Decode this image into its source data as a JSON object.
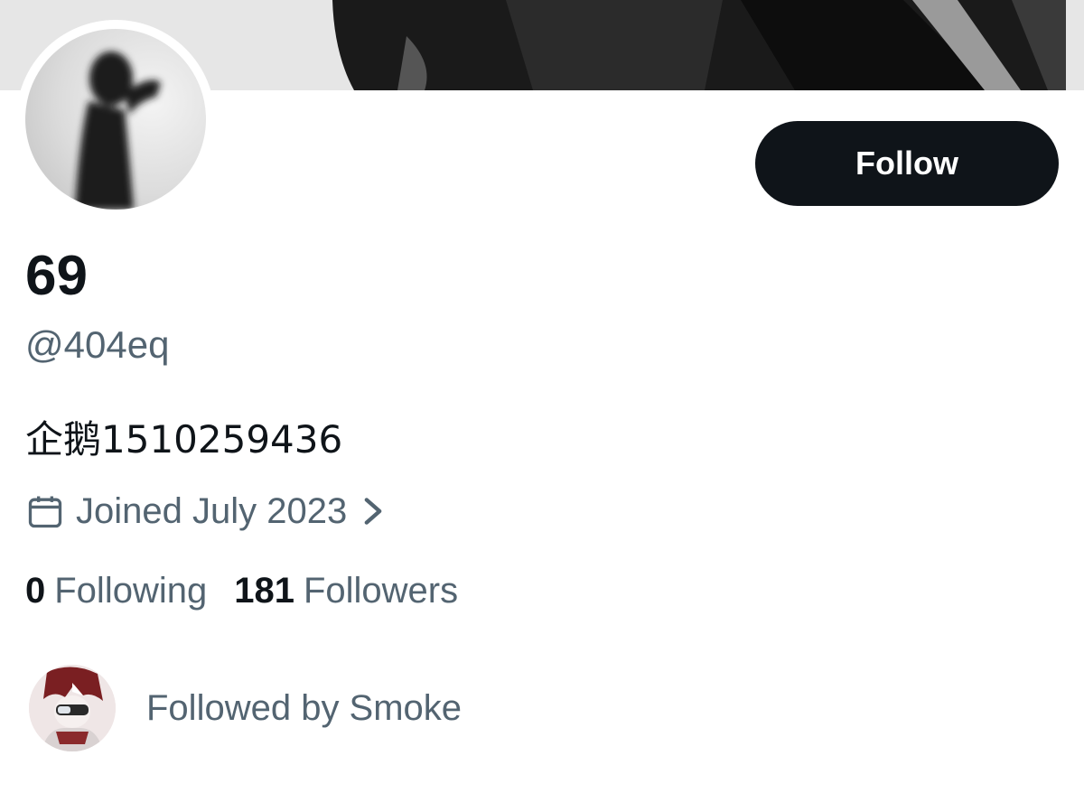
{
  "profile": {
    "display_name": "69",
    "handle": "@404eq",
    "bio": "企鹅1510259436",
    "joined": "Joined July 2023",
    "following_count": "0",
    "following_label": "Following",
    "followers_count": "181",
    "followers_label": "Followers",
    "followed_by": "Followed by Smoke"
  },
  "actions": {
    "follow_label": "Follow"
  },
  "icons": {
    "joined": "calendar-icon",
    "joined_more": "chevron-right-icon"
  },
  "colors": {
    "text_primary": "#0f1419",
    "text_secondary": "#536471",
    "button_bg": "#0f1419",
    "button_text": "#ffffff"
  }
}
